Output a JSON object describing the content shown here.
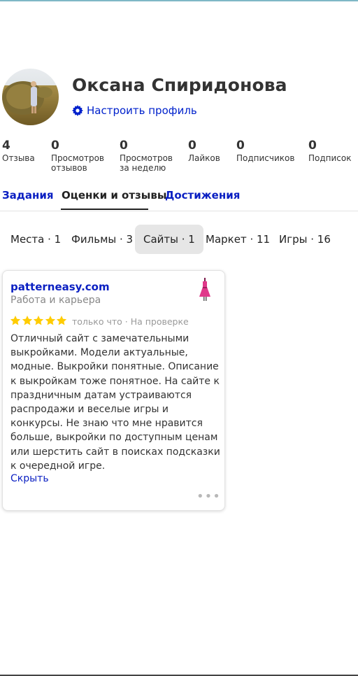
{
  "profile": {
    "name": "Оксана Спиридонова",
    "settings_label": "Настроить профиль"
  },
  "stats": [
    {
      "value": "4",
      "label": "Отзыва"
    },
    {
      "value": "0",
      "label": "Просмотров\nотзывов"
    },
    {
      "value": "0",
      "label": "Просмотров\nза неделю"
    },
    {
      "value": "0",
      "label": "Лайков"
    },
    {
      "value": "0",
      "label": "Подписчиков"
    },
    {
      "value": "0",
      "label": "Подписок"
    }
  ],
  "tabs": [
    {
      "label": "Задания",
      "active": false
    },
    {
      "label": "Оценки и отзывы",
      "active": true
    },
    {
      "label": "Достижения",
      "active": false
    }
  ],
  "categories": [
    {
      "label": "Места · 1",
      "active": false
    },
    {
      "label": "Фильмы · 3",
      "active": false
    },
    {
      "label": "Сайты · 1",
      "active": true
    },
    {
      "label": "Маркет · 11",
      "active": false
    },
    {
      "label": "Игры · 16",
      "active": false
    }
  ],
  "review": {
    "site": "patterneasy.com",
    "category": "Работа и карьера",
    "rating": 5,
    "meta": "только что · На проверке",
    "text": "Отличный сайт с замечательными выкройками. Модели актуальные, модные. Выкройки понятные. Описание к выкройкам тоже понятное. На сайте к праздничным датам устраиваются распродажи и веселые игры и конкурсы. Не знаю что мне нравится больше, выкройки по доступным ценам или шерстить сайт в поисках подсказки к очередной игре.",
    "hide_label": "Скрыть",
    "more_label": "•••"
  },
  "colors": {
    "link": "#0a1fc2",
    "star": "#fc0",
    "chip_active_bg": "#e6e6e6"
  }
}
